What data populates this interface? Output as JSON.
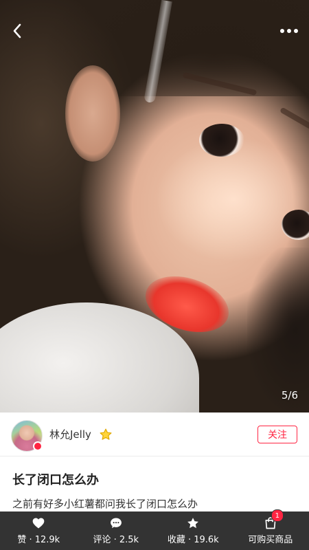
{
  "nav": {
    "back_icon": "chevron-left-icon",
    "more_icon": "more-dots-icon"
  },
  "photo": {
    "page_indicator": "5/6"
  },
  "author": {
    "name": "林允Jelly",
    "follow_label": "关注",
    "badge_icon": "star-icon"
  },
  "post": {
    "title": "长了闭口怎么办",
    "body": "之前有好多小红薯都问我长了闭口怎么办"
  },
  "bottom_bar": {
    "like_label": "赞 · 12.9k",
    "comment_label": "评论 · 2.5k",
    "collect_label": "收藏 · 19.6k",
    "shop_label": "可购买商品",
    "cart_count": "1"
  },
  "colors": {
    "accent": "#ff2442",
    "bottom_bar_bg": "#333333"
  }
}
